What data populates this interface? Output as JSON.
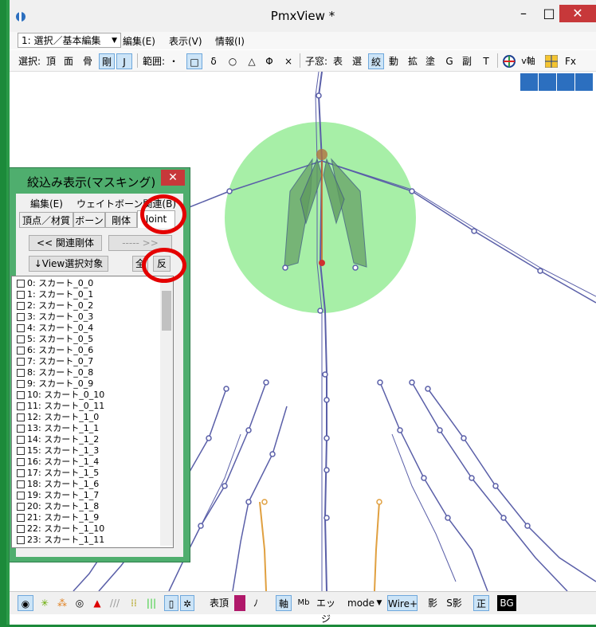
{
  "window": {
    "title": "PmxView *",
    "minimize": "–",
    "maximize": "□",
    "close": "✕"
  },
  "menubar": {
    "mode": "1: 選択／基本編集",
    "items": [
      "編集(E)",
      "表示(V)",
      "情報(I)"
    ]
  },
  "toolbar": {
    "select_label": "選択:",
    "select_items": [
      "頂",
      "面",
      "骨",
      "剛",
      "J"
    ],
    "range_label": "範囲:",
    "range_items": [
      "・",
      "□",
      "δ",
      "○",
      "△",
      "Φ",
      "×"
    ],
    "child_label": "子窓:",
    "child_items": [
      "表",
      "選",
      "絞",
      "動",
      "拡",
      "塗",
      "G",
      "副",
      "T"
    ],
    "vaxis": "v軸",
    "fx": "Fx"
  },
  "dialog": {
    "title": "絞込み表示(マスキング)",
    "close": "✕",
    "menu": [
      "編集(E)",
      "ウェイトボーン関連(B)"
    ],
    "tabs": [
      "頂点／材質",
      "ボーン",
      "剛体",
      "Joint"
    ],
    "related_rigid_button": "<< 関連剛体",
    "disabled_button": "----- >>",
    "view_select_button": "↓View選択対象",
    "all_button": "全",
    "invert_button": "反",
    "items": [
      "0: スカート_0_0",
      "1: スカート_0_1",
      "2: スカート_0_2",
      "3: スカート_0_3",
      "4: スカート_0_4",
      "5: スカート_0_5",
      "6: スカート_0_6",
      "7: スカート_0_7",
      "8: スカート_0_8",
      "9: スカート_0_9",
      "10: スカート_0_10",
      "11: スカート_0_11",
      "12: スカート_1_0",
      "13: スカート_1_1",
      "14: スカート_1_2",
      "15: スカート_1_3",
      "16: スカート_1_4",
      "17: スカート_1_5",
      "18: スカート_1_6",
      "19: スカート_1_7",
      "20: スカート_1_8",
      "21: スカート_1_9",
      "22: スカート_1_10",
      "23: スカート_1_11"
    ]
  },
  "bottombar": {
    "hyocho": "表頂",
    "no": "ﾉ",
    "jiku": "軸",
    "mb": "Mb",
    "edge": "エッジ",
    "mode": "mode",
    "wire": "Wire+",
    "shadow": "影",
    "sshadow": "S影",
    "sei": "正",
    "bg": "BG"
  },
  "colors": {
    "accent_red": "#e40000",
    "rigid_sphere": "#90ee90",
    "joint_lines": "#5a5fa8",
    "dialog_green": "#4fae6e"
  }
}
